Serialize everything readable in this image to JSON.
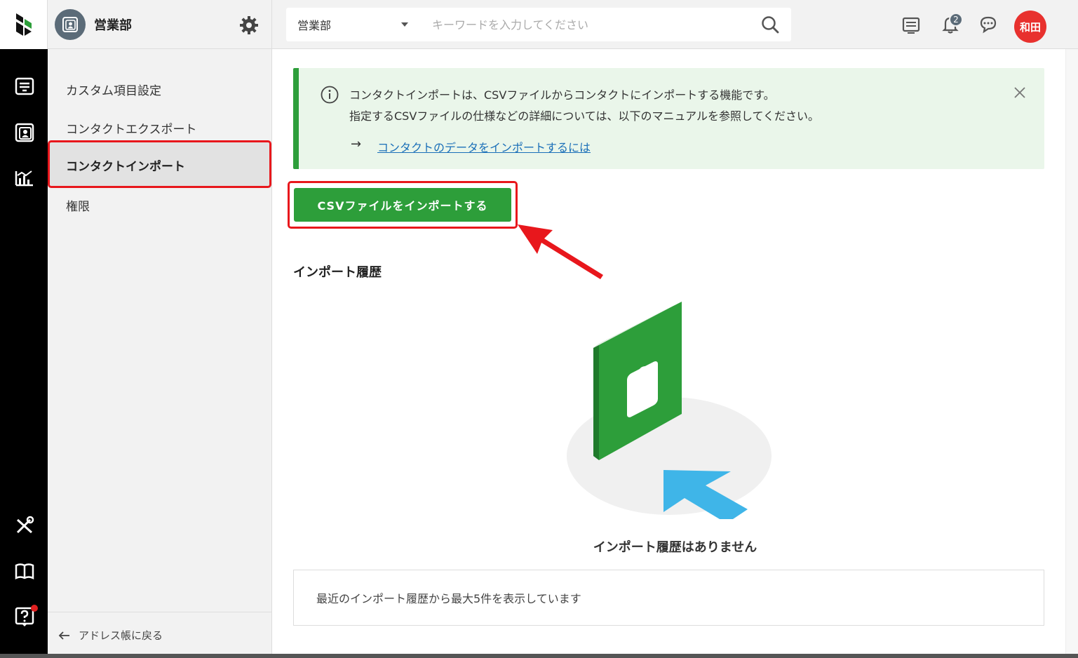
{
  "colors": {
    "accent_green": "#2d9e3a",
    "highlight_red": "#e8171c",
    "link_blue": "#1a6fb8",
    "avatar_red": "#e8312e",
    "rail_bg": "#000000"
  },
  "rail": {
    "icons": [
      "logo-icon",
      "dashboard-icon",
      "contacts-icon",
      "analytics-icon",
      "tools-icon",
      "manual-icon",
      "help-icon"
    ]
  },
  "topbar": {
    "department": "営業部",
    "search_scope": "営業部",
    "search_placeholder": "キーワードを入力してください",
    "notification_count": "2",
    "user_initials": "和田"
  },
  "sidebar": {
    "items": [
      {
        "label": "カスタム項目設定"
      },
      {
        "label": "コンタクトエクスポート"
      },
      {
        "label": "コンタクトインポート"
      },
      {
        "label": "権限"
      }
    ],
    "back_label": "アドレス帳に戻る"
  },
  "notice": {
    "line1": "コンタクトインポートは、CSVファイルからコンタクトにインポートする機能です。",
    "line2": "指定するCSVファイルの仕様などの詳細については、以下のマニュアルを参照してください。",
    "arrow": "→",
    "link_text": "コンタクトのデータをインポートするには"
  },
  "main": {
    "import_button": "CSVファイルをインポートする",
    "history_title": "インポート履歴",
    "empty_text": "インポート履歴はありません",
    "footer_note": "最近のインポート履歴から最大5件を表示しています"
  }
}
